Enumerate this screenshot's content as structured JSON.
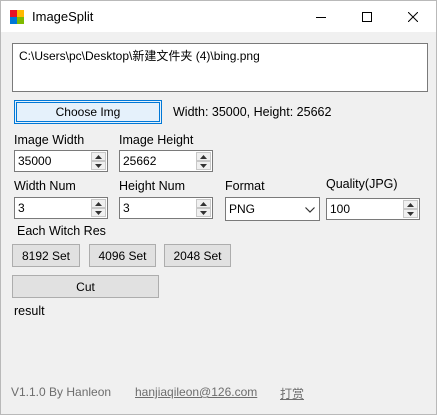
{
  "window": {
    "title": "ImageSplit"
  },
  "path_box": {
    "value": "C:\\Users\\pc\\Desktop\\新建文件夹 (4)\\bing.png"
  },
  "choose": {
    "button_label": "Choose Img",
    "info": "Width: 35000, Height: 25662"
  },
  "image_width": {
    "label": "Image Width",
    "value": "35000"
  },
  "image_height": {
    "label": "Image Height",
    "value": "25662"
  },
  "width_num": {
    "label": "Width Num",
    "value": "3"
  },
  "height_num": {
    "label": "Height Num",
    "value": "3"
  },
  "format": {
    "label": "Format",
    "selected": "PNG"
  },
  "quality": {
    "label": "Quality(JPG)",
    "value": "100"
  },
  "res": {
    "label": "Each Witch Res",
    "buttons": [
      "8192 Set",
      "4096 Set",
      "2048 Set"
    ]
  },
  "cut": {
    "label": "Cut"
  },
  "result": {
    "text": "result"
  },
  "footer": {
    "version": "V1.1.0 By Hanleon",
    "email": "hanjiaqileon@126.com",
    "donate": "打赏"
  },
  "colors": {
    "focus_blue": "#0078d7",
    "button_bg": "#e1e1e1",
    "window_bg": "#f0f0f0"
  }
}
